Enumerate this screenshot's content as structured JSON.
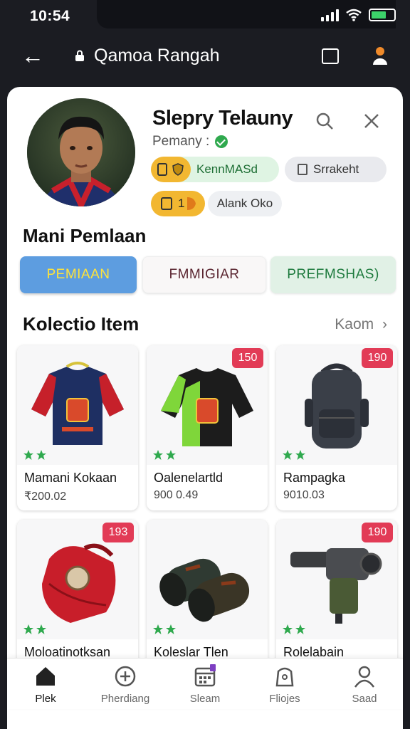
{
  "status": {
    "time": "10:54"
  },
  "appbar": {
    "title": "Qamoa Rangah"
  },
  "profile": {
    "name": "Slepry Telauny",
    "subtitle": "Pemany :",
    "badge_green": "KennMASd",
    "badge_green_icon_text": "▣ ☺",
    "badge_grey": "Srrakeht",
    "badge_yellow": "1",
    "badge_light": "Alank Oko"
  },
  "section_main": {
    "title": "Mani Pemlaan"
  },
  "tabs": [
    {
      "label": "PEMIAAN"
    },
    {
      "label": "FMMIGIAR"
    },
    {
      "label": "PREFMSHAS)"
    }
  ],
  "section_collection": {
    "title": "Kolectio Item",
    "see_all": "Kaom"
  },
  "items": [
    {
      "name": "Mamani Kokaan",
      "price": "₹200.02",
      "badge": "",
      "art": "jersey-navy"
    },
    {
      "name": "Oalenelartld",
      "price": "900 0.49",
      "badge": "150",
      "art": "jersey-green"
    },
    {
      "name": "Rampagka",
      "price": "9010.03",
      "badge": "190",
      "art": "backpack"
    },
    {
      "name": "Moloatinotksan",
      "price": "",
      "badge": "193",
      "art": "red-bag"
    },
    {
      "name": "Koleslar Tlen",
      "price": "",
      "badge": "",
      "art": "camo-rolls"
    },
    {
      "name": "Rolelabain",
      "price": "",
      "badge": "190",
      "art": "binocular-device"
    }
  ],
  "bottom_nav": [
    {
      "label": "Plek",
      "icon": "home-icon"
    },
    {
      "label": "Pherdiang",
      "icon": "plus-circle-icon"
    },
    {
      "label": "Sleam",
      "icon": "calendar-icon"
    },
    {
      "label": "Fliojes",
      "icon": "bag-icon"
    },
    {
      "label": "Saad",
      "icon": "user-icon"
    }
  ],
  "colors": {
    "accent_blue": "#5d9de0",
    "badge_red": "#e23b56",
    "green": "#2fa94e",
    "yellow": "#f2b731"
  }
}
